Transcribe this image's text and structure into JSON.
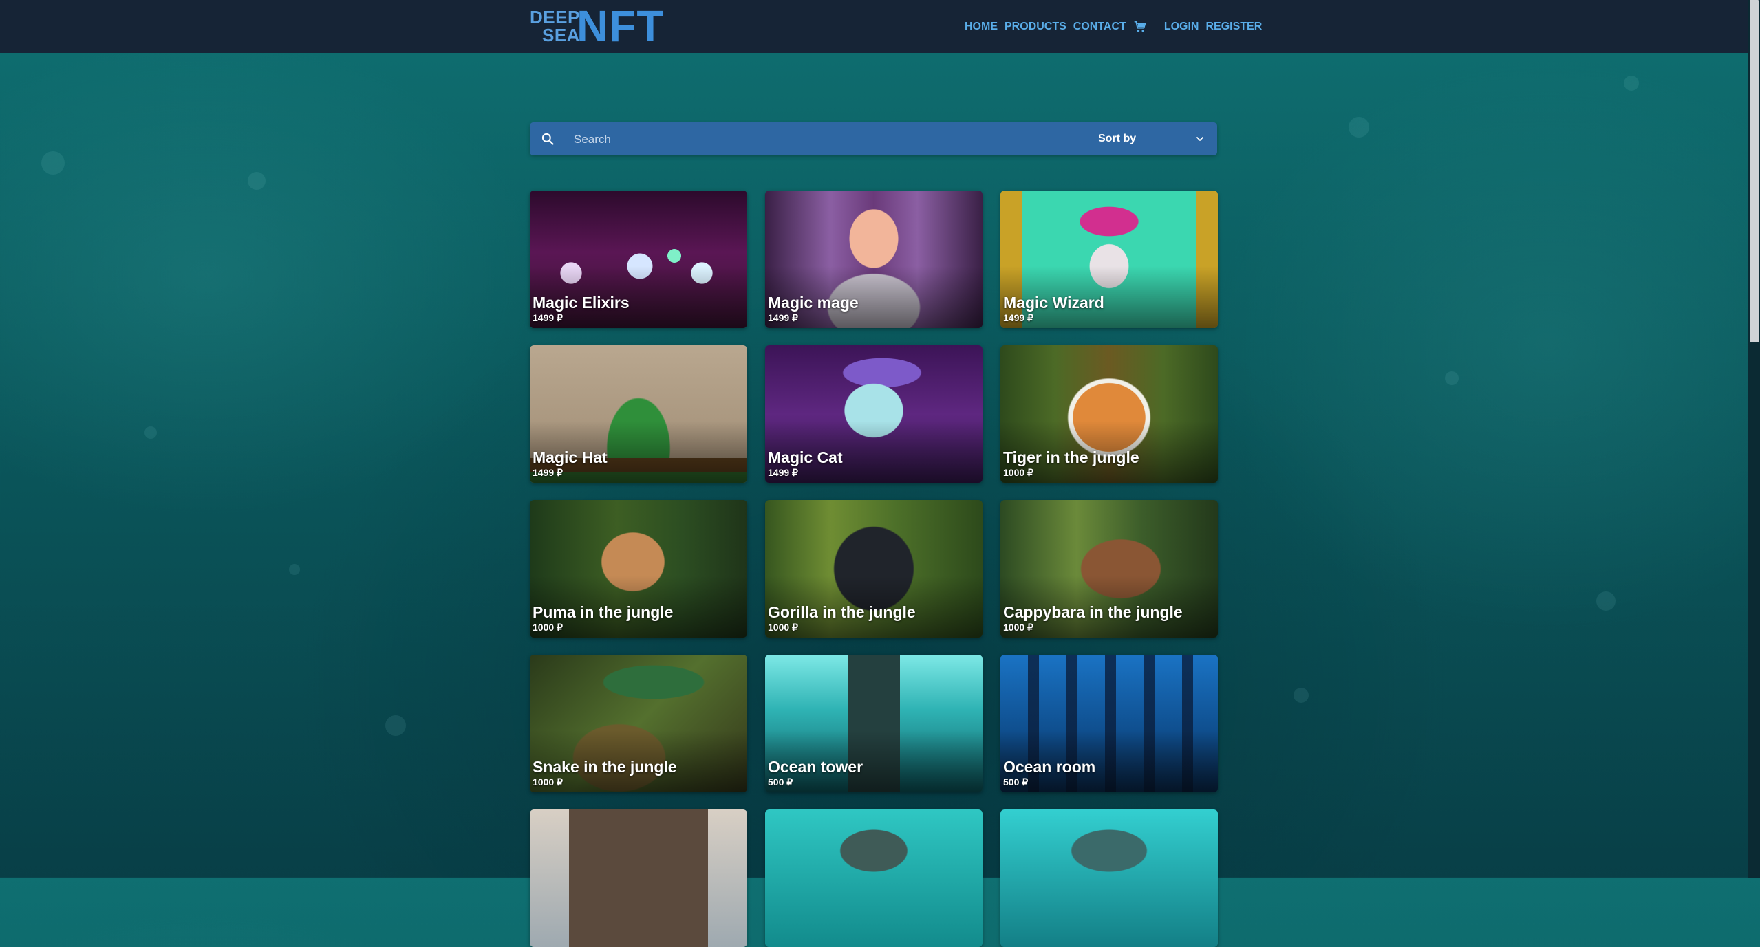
{
  "header": {
    "logo": {
      "line1": "DEEP",
      "line2": "SEA",
      "big": "NFT"
    },
    "nav": {
      "home": "HOME",
      "products": "PRODUCTS",
      "contact": "CONTACT",
      "cart_icon": "cart-icon",
      "login": "LOGIN",
      "register": "REGISTER"
    }
  },
  "search": {
    "placeholder": "Search",
    "value": "",
    "sort_label": "Sort by",
    "icon": "search-icon",
    "sort_icon": "chevron-down-icon"
  },
  "products": [
    {
      "title": "Magic Elixirs",
      "price": "1499 ₽"
    },
    {
      "title": "Magic mage",
      "price": "1499 ₽"
    },
    {
      "title": "Magic Wizard",
      "price": "1499 ₽"
    },
    {
      "title": "Magic Hat",
      "price": "1499 ₽"
    },
    {
      "title": "Magic Cat",
      "price": "1499 ₽"
    },
    {
      "title": "Tiger in the jungle",
      "price": "1000 ₽"
    },
    {
      "title": "Puma in the jungle",
      "price": "1000 ₽"
    },
    {
      "title": "Gorilla in the jungle",
      "price": "1000 ₽"
    },
    {
      "title": "Cappybara in the jungle",
      "price": "1000 ₽"
    },
    {
      "title": "Snake in the jungle",
      "price": "1000 ₽"
    },
    {
      "title": "Ocean tower",
      "price": "500 ₽"
    },
    {
      "title": "Ocean room",
      "price": "500 ₽"
    },
    {
      "title": "",
      "price": ""
    },
    {
      "title": "",
      "price": ""
    },
    {
      "title": "",
      "price": ""
    }
  ],
  "colors": {
    "header_bg": "#162436",
    "nav_link": "#5aaeea",
    "logo": "#3d8fdc",
    "search_bg": "#2e67a3"
  }
}
